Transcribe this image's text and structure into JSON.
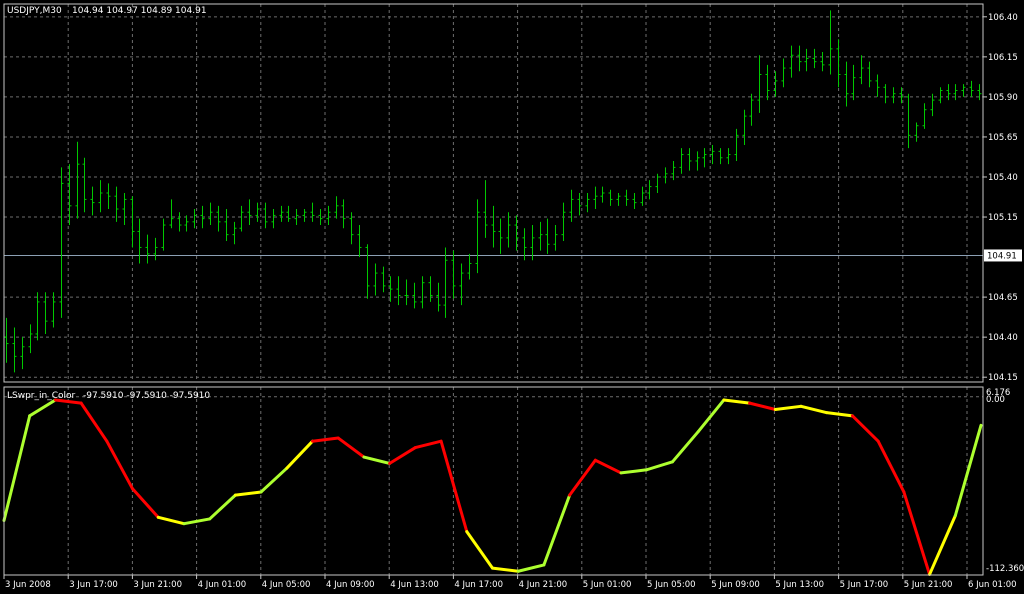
{
  "window": {
    "symbol_title": "USDJPY,M30",
    "ohlc_text": "104.94 104.97 104.89 104.91",
    "indicator_title": "LSwpr_in_Color",
    "indicator_values_text": "-97.5910 -97.5910 -97.5910"
  },
  "colors": {
    "background": "#000000",
    "grid": "#6e6e6e",
    "bars": "#00c800",
    "bid_line": "#8ca0b4",
    "bid_label_bg": "#ffffff",
    "bid_label_text": "#000000",
    "rising": "#adff2f",
    "falling": "#ff0000",
    "flat": "#ffff00"
  },
  "chart_data": [
    {
      "type": "ohlc",
      "title": "USDJPY,M30",
      "y_axis_labels": [
        "106.40",
        "106.15",
        "105.90",
        "105.65",
        "105.40",
        "105.15",
        "104.91",
        "104.65",
        "104.40",
        "104.15"
      ],
      "ylim": [
        104.12,
        106.48
      ],
      "current_price": 104.91,
      "current_price_label": "104.91",
      "grid": true,
      "bars": [
        [
          104.4,
          104.52,
          104.24,
          104.36
        ],
        [
          104.36,
          104.46,
          104.18,
          104.28
        ],
        [
          104.28,
          104.4,
          104.2,
          104.34
        ],
        [
          104.34,
          104.48,
          104.3,
          104.42
        ],
        [
          104.42,
          104.68,
          104.38,
          104.62
        ],
        [
          104.62,
          104.68,
          104.42,
          104.5
        ],
        [
          104.5,
          104.68,
          104.46,
          104.62
        ],
        [
          104.62,
          105.46,
          104.52,
          105.36
        ],
        [
          105.36,
          105.48,
          105.1,
          105.22
        ],
        [
          105.22,
          105.62,
          105.14,
          105.48
        ],
        [
          105.48,
          105.52,
          105.18,
          105.26
        ],
        [
          105.26,
          105.34,
          105.16,
          105.24
        ],
        [
          105.24,
          105.38,
          105.18,
          105.3
        ],
        [
          105.3,
          105.36,
          105.2,
          105.28
        ],
        [
          105.28,
          105.34,
          105.12,
          105.2
        ],
        [
          105.2,
          105.3,
          105.1,
          105.26
        ],
        [
          105.26,
          105.28,
          104.96,
          105.06
        ],
        [
          105.06,
          105.14,
          104.86,
          104.96
        ],
        [
          104.96,
          105.04,
          104.86,
          104.92
        ],
        [
          104.92,
          105.02,
          104.88,
          104.96
        ],
        [
          104.96,
          105.14,
          104.94,
          105.1
        ],
        [
          105.1,
          105.26,
          105.08,
          105.14
        ],
        [
          105.14,
          105.18,
          105.06,
          105.1
        ],
        [
          105.1,
          105.16,
          105.06,
          105.12
        ],
        [
          105.12,
          105.2,
          105.08,
          105.16
        ],
        [
          105.16,
          105.22,
          105.08,
          105.14
        ],
        [
          105.14,
          105.24,
          105.1,
          105.18
        ],
        [
          105.18,
          105.22,
          105.06,
          105.12
        ],
        [
          105.12,
          105.2,
          105.0,
          105.04
        ],
        [
          105.04,
          105.12,
          104.98,
          105.08
        ],
        [
          105.08,
          105.22,
          105.06,
          105.18
        ],
        [
          105.18,
          105.26,
          105.1,
          105.16
        ],
        [
          105.16,
          105.24,
          105.12,
          105.2
        ],
        [
          105.2,
          105.24,
          105.08,
          105.12
        ],
        [
          105.12,
          105.2,
          105.08,
          105.16
        ],
        [
          105.16,
          105.22,
          105.12,
          105.18
        ],
        [
          105.18,
          105.22,
          105.12,
          105.14
        ],
        [
          105.14,
          105.2,
          105.1,
          105.16
        ],
        [
          105.16,
          105.2,
          105.12,
          105.18
        ],
        [
          105.18,
          105.24,
          105.12,
          105.16
        ],
        [
          105.16,
          105.2,
          105.1,
          105.14
        ],
        [
          105.14,
          105.22,
          105.1,
          105.18
        ],
        [
          105.18,
          105.28,
          105.14,
          105.22
        ],
        [
          105.22,
          105.26,
          105.08,
          105.14
        ],
        [
          105.14,
          105.18,
          104.98,
          105.04
        ],
        [
          105.04,
          105.1,
          104.9,
          104.96
        ],
        [
          104.96,
          104.98,
          104.64,
          104.72
        ],
        [
          104.72,
          104.86,
          104.66,
          104.8
        ],
        [
          104.8,
          104.84,
          104.68,
          104.72
        ],
        [
          104.72,
          104.78,
          104.62,
          104.7
        ],
        [
          104.7,
          104.78,
          104.6,
          104.66
        ],
        [
          104.66,
          104.76,
          104.6,
          104.66
        ],
        [
          104.66,
          104.74,
          104.58,
          104.62
        ],
        [
          104.62,
          104.78,
          104.58,
          104.74
        ],
        [
          104.74,
          104.78,
          104.62,
          104.66
        ],
        [
          104.66,
          104.74,
          104.56,
          104.6
        ],
        [
          104.6,
          104.96,
          104.52,
          104.88
        ],
        [
          104.88,
          104.94,
          104.64,
          104.72
        ],
        [
          104.72,
          104.86,
          104.6,
          104.8
        ],
        [
          104.8,
          104.92,
          104.76,
          104.86
        ],
        [
          104.86,
          105.26,
          104.8,
          105.18
        ],
        [
          105.18,
          105.38,
          105.02,
          105.1
        ],
        [
          105.1,
          105.22,
          104.96,
          105.06
        ],
        [
          105.06,
          105.14,
          104.92,
          105.02
        ],
        [
          105.02,
          105.18,
          104.96,
          105.1
        ],
        [
          105.1,
          105.16,
          104.94,
          105.02
        ],
        [
          105.02,
          105.08,
          104.88,
          104.96
        ],
        [
          104.96,
          105.1,
          104.88,
          105.02
        ],
        [
          105.02,
          105.12,
          104.94,
          105.04
        ],
        [
          105.04,
          105.14,
          104.92,
          104.98
        ],
        [
          104.98,
          105.1,
          104.94,
          105.04
        ],
        [
          105.04,
          105.24,
          105.0,
          105.18
        ],
        [
          105.18,
          105.32,
          105.12,
          105.26
        ],
        [
          105.26,
          105.3,
          105.16,
          105.22
        ],
        [
          105.22,
          105.3,
          105.18,
          105.26
        ],
        [
          105.26,
          105.34,
          105.2,
          105.28
        ],
        [
          105.28,
          105.34,
          105.24,
          105.3
        ],
        [
          105.3,
          105.32,
          105.22,
          105.26
        ],
        [
          105.26,
          105.3,
          105.22,
          105.28
        ],
        [
          105.28,
          105.32,
          105.22,
          105.26
        ],
        [
          105.26,
          105.3,
          105.2,
          105.24
        ],
        [
          105.24,
          105.34,
          105.22,
          105.3
        ],
        [
          105.3,
          105.38,
          105.26,
          105.34
        ],
        [
          105.34,
          105.42,
          105.3,
          105.4
        ],
        [
          105.4,
          105.46,
          105.36,
          105.42
        ],
        [
          105.42,
          105.5,
          105.38,
          105.46
        ],
        [
          105.46,
          105.58,
          105.42,
          105.54
        ],
        [
          105.54,
          105.58,
          105.44,
          105.5
        ],
        [
          105.5,
          105.56,
          105.44,
          105.52
        ],
        [
          105.52,
          105.58,
          105.46,
          105.54
        ],
        [
          105.54,
          105.6,
          105.48,
          105.56
        ],
        [
          105.56,
          105.58,
          105.48,
          105.52
        ],
        [
          105.52,
          105.58,
          105.48,
          105.54
        ],
        [
          105.54,
          105.7,
          105.5,
          105.66
        ],
        [
          105.66,
          105.82,
          105.6,
          105.78
        ],
        [
          105.78,
          105.92,
          105.72,
          105.88
        ],
        [
          105.88,
          106.16,
          105.8,
          106.04
        ],
        [
          106.04,
          106.1,
          105.88,
          105.94
        ],
        [
          105.94,
          106.06,
          105.9,
          106.0
        ],
        [
          106.0,
          106.14,
          105.96,
          106.08
        ],
        [
          106.08,
          106.22,
          106.02,
          106.16
        ],
        [
          106.16,
          106.22,
          106.06,
          106.12
        ],
        [
          106.12,
          106.2,
          106.06,
          106.14
        ],
        [
          106.14,
          106.2,
          106.08,
          106.12
        ],
        [
          106.12,
          106.18,
          106.06,
          106.1
        ],
        [
          106.1,
          106.44,
          106.04,
          106.2
        ],
        [
          106.2,
          106.26,
          105.96,
          106.04
        ],
        [
          106.04,
          106.12,
          105.84,
          105.92
        ],
        [
          105.92,
          106.1,
          105.88,
          106.02
        ],
        [
          106.02,
          106.16,
          105.98,
          106.08
        ],
        [
          106.08,
          106.12,
          105.96,
          106.0
        ],
        [
          106.0,
          106.04,
          105.9,
          105.96
        ],
        [
          105.96,
          105.98,
          105.86,
          105.9
        ],
        [
          105.9,
          105.96,
          105.86,
          105.92
        ],
        [
          105.92,
          105.96,
          105.86,
          105.9
        ],
        [
          105.9,
          105.92,
          105.58,
          105.66
        ],
        [
          105.66,
          105.74,
          105.62,
          105.72
        ],
        [
          105.72,
          105.86,
          105.7,
          105.82
        ],
        [
          105.82,
          105.92,
          105.78,
          105.88
        ],
        [
          105.88,
          105.96,
          105.86,
          105.94
        ],
        [
          105.94,
          105.98,
          105.88,
          105.92
        ],
        [
          105.92,
          105.98,
          105.88,
          105.94
        ],
        [
          105.94,
          105.98,
          105.9,
          105.96
        ],
        [
          105.96,
          106.0,
          105.9,
          105.94
        ],
        [
          105.94,
          105.98,
          105.88,
          105.92
        ]
      ]
    },
    {
      "type": "line",
      "title": "LSwpr_in_Color",
      "y_axis_labels": [
        "6.176",
        "0.00",
        "-112.360"
      ],
      "ylim": [
        -112.36,
        6.176
      ],
      "grid": true,
      "color_legend": {
        "rising": "#adff2f",
        "falling": "#ff0000",
        "flat": "#ffff00"
      },
      "x": [
        0,
        4,
        8,
        12,
        16,
        20,
        24,
        28,
        32,
        36,
        40,
        44,
        48,
        52,
        56,
        60,
        64,
        68,
        72,
        76,
        80,
        84,
        88,
        92,
        96,
        100,
        104,
        108,
        112,
        116,
        120,
        124,
        127
      ],
      "values": [
        -78,
        -12,
        -2,
        -4,
        -28,
        -58,
        -76,
        -80,
        -77,
        -62,
        -60,
        -45,
        -28,
        -26,
        -38,
        -42,
        -32,
        -28,
        -85,
        -108,
        -110,
        -106,
        -62,
        -40,
        -48,
        -46,
        -41,
        -22,
        -2,
        -4,
        -8,
        -6,
        -10,
        -12,
        -28,
        -60,
        -112,
        -75,
        -18
      ],
      "segment_colors": [
        "rising",
        "rising",
        "falling",
        "falling",
        "falling",
        "falling",
        "flat",
        "rising",
        "rising",
        "flat",
        "rising",
        "flat",
        "falling",
        "falling",
        "rising",
        "falling",
        "falling",
        "falling",
        "flat",
        "flat",
        "rising",
        "rising",
        "falling",
        "falling",
        "rising",
        "rising",
        "rising",
        "rising",
        "flat",
        "falling",
        "flat",
        "flat",
        "flat",
        "falling",
        "falling",
        "falling",
        "flat",
        "rising"
      ]
    }
  ],
  "x_axis_labels": [
    "3 Jun 2008",
    "3 Jun 17:00",
    "3 Jun 21:00",
    "4 Jun 01:00",
    "4 Jun 05:00",
    "4 Jun 09:00",
    "4 Jun 13:00",
    "4 Jun 17:00",
    "4 Jun 21:00",
    "5 Jun 01:00",
    "5 Jun 05:00",
    "5 Jun 09:00",
    "5 Jun 13:00",
    "5 Jun 17:00",
    "5 Jun 21:00",
    "6 Jun 01:00"
  ]
}
